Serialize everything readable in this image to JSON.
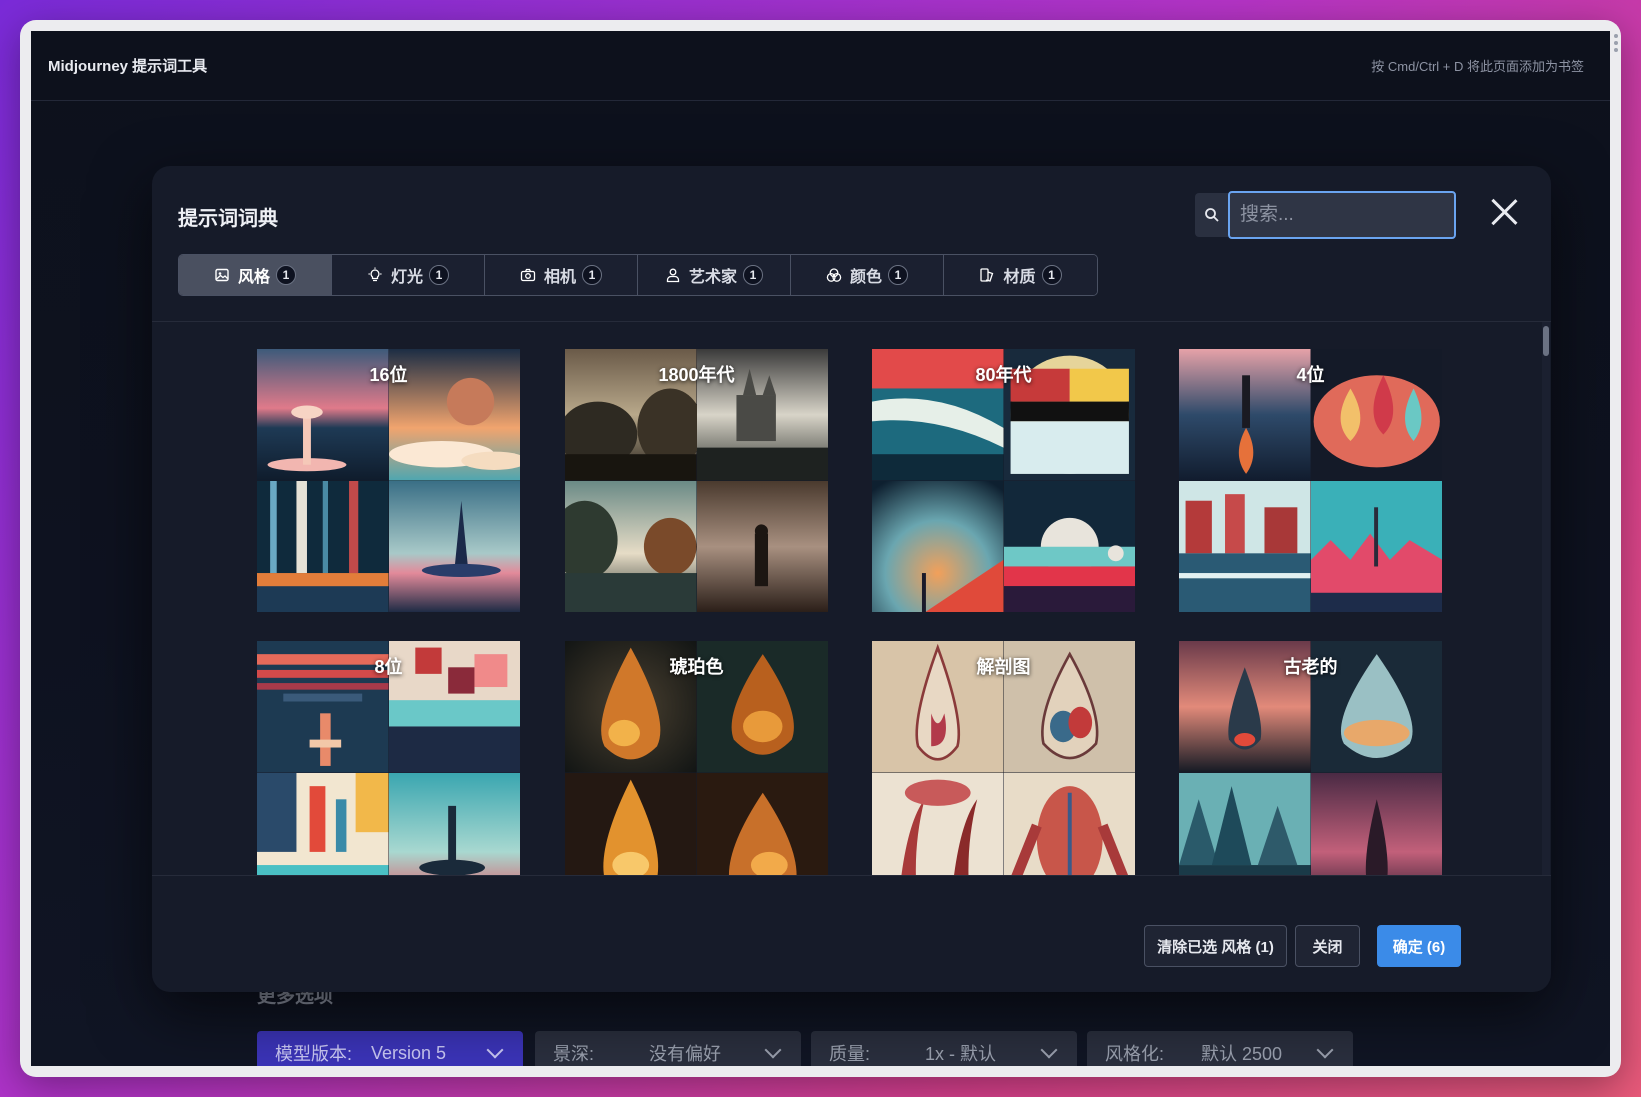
{
  "app": {
    "brand": "Midjourney 提示词工具",
    "bookmark_hint": "按 Cmd/Ctrl + D 将此页面添加为书签"
  },
  "modal": {
    "title": "提示词词典",
    "search_placeholder": "搜索...",
    "tabs": [
      {
        "label": "风格",
        "count": "1",
        "icon": "image-icon",
        "active": true
      },
      {
        "label": "灯光",
        "count": "1",
        "icon": "bulb-icon",
        "active": false
      },
      {
        "label": "相机",
        "count": "1",
        "icon": "camera-icon",
        "active": false
      },
      {
        "label": "艺术家",
        "count": "1",
        "icon": "artist-icon",
        "active": false
      },
      {
        "label": "颜色",
        "count": "1",
        "icon": "color-icon",
        "active": false
      },
      {
        "label": "材质",
        "count": "1",
        "icon": "material-icon",
        "active": false
      }
    ],
    "styles": [
      {
        "label": "16位"
      },
      {
        "label": "1800年代"
      },
      {
        "label": "80年代"
      },
      {
        "label": "4位"
      },
      {
        "label": "8位"
      },
      {
        "label": "琥珀色"
      },
      {
        "label": "解剖图"
      },
      {
        "label": "古老的"
      }
    ],
    "buttons": {
      "clear": "清除已选 风格 (1)",
      "close": "关闭",
      "confirm": "确定 (6)"
    }
  },
  "more_options": {
    "title": "更多选项",
    "selects": [
      {
        "label": "模型版本:",
        "value": "Version 5"
      },
      {
        "label": "景深:",
        "value": "没有偏好"
      },
      {
        "label": "质量:",
        "value": "1x - 默认"
      },
      {
        "label": "风格化:",
        "value": "默认 2500"
      }
    ]
  },
  "colors": {
    "accent_blue": "#3b8be8",
    "model_select": "#3b34b8",
    "modal_bg": "#161b29"
  }
}
